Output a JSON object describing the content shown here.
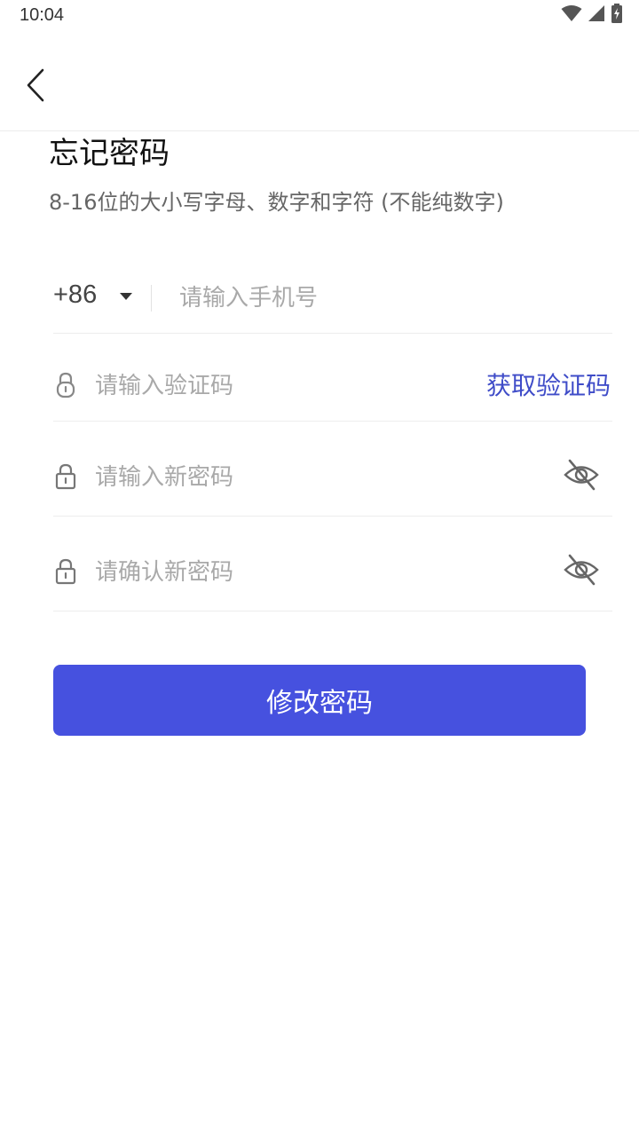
{
  "status_bar": {
    "time": "10:04",
    "icons": [
      "wifi-icon",
      "cellular-signal-icon",
      "battery-charging-icon"
    ]
  },
  "header": {
    "back_icon": "chevron-left-icon"
  },
  "title": "忘记密码",
  "subtitle": "8-16位的大小写字母、数字和字符 (不能纯数字)",
  "form": {
    "phone": {
      "country_code": "+86",
      "placeholder": "请输入手机号",
      "value": ""
    },
    "code": {
      "placeholder": "请输入验证码",
      "value": "",
      "get_code_label": "获取验证码"
    },
    "new_password": {
      "placeholder": "请输入新密码",
      "value": ""
    },
    "confirm_password": {
      "placeholder": "请确认新密码",
      "value": ""
    }
  },
  "submit_label": "修改密码",
  "colors": {
    "accent": "#4651df",
    "link": "#3f4cc8",
    "placeholder": "#a9a9a9",
    "divider": "#ededed"
  }
}
